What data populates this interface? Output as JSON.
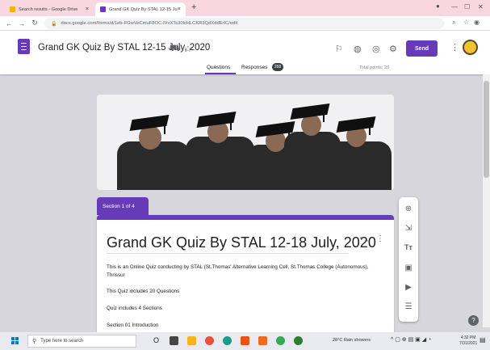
{
  "browser": {
    "tabs": [
      {
        "title": "Search results - Google Drive",
        "favicon_color": "#f4b400"
      },
      {
        "title": "Grand GK Quiz By STAL 12-15 Ju",
        "favicon_color": "#673ab7"
      }
    ],
    "new_tab_symbol": "+",
    "url": "docs.google.com/forms/d/1eb-FGwVeCmuF8OC-IVvXTs30lcHLCKR3QdXddErIC/edit"
  },
  "form_header": {
    "title": "Grand GK Quiz By STAL 12-15 July, 2020",
    "send_label": "Send",
    "questions_tab": "Questions",
    "responses_tab": "Responses",
    "responses_count": "268",
    "total_points": "Total points: 20"
  },
  "section": {
    "label": "Section 1 of 4",
    "title": "Grand GK Quiz By STAL 12-18 July, 2020",
    "description": "This is an Online Quiz  conducting by STAL (St.Thomas' Alternative Learning Cell, St.Thomas College (Autonomous), Thrissur",
    "line2": "This Quiz includes 20 Questions",
    "line3": "Quiz includes 4 Sections",
    "line4": "Section 01 Introduction"
  },
  "toolbar": {
    "icons": [
      "add-question-icon",
      "import-questions-icon",
      "add-title-icon",
      "add-image-icon",
      "add-video-icon",
      "add-section-icon"
    ]
  },
  "taskbar": {
    "search_placeholder": "Type here to search",
    "weather": "28°C  Rain showers",
    "time": "4:32 PM",
    "date": "7/31/2021"
  },
  "colors": {
    "accent": "#673ab7",
    "tab_strip": "#f9d7e1",
    "background": "#d7d6dd"
  }
}
